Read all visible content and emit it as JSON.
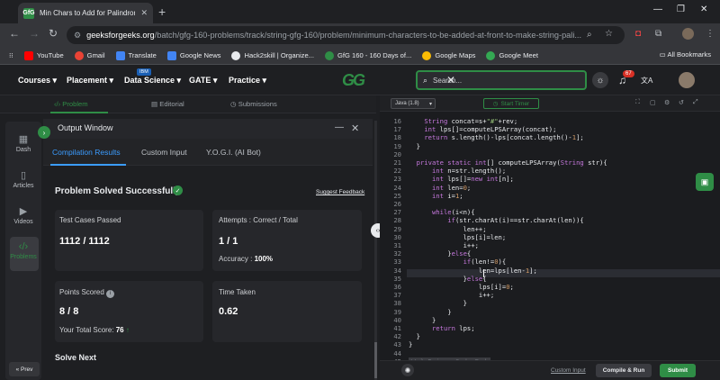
{
  "browser": {
    "tab_title": "Min Chars to Add for Palindrome |",
    "tab_favicon": "GfG",
    "new_tab": "+",
    "url_host": "geeksforgeeks.org",
    "url_path": "/batch/gfg-160-problems/track/string-gfg-160/problem/minimum-characters-to-be-added-at-front-to-make-string-pali...",
    "bookmarks": [
      "YouTube",
      "Gmail",
      "Translate",
      "Google News",
      "Hack2skill | Organize...",
      "GfG 160 - 160 Days of...",
      "Google Maps",
      "Google Meet"
    ],
    "all_bookmarks": "All Bookmarks",
    "notification_count": "67"
  },
  "nav": {
    "items": [
      "Courses",
      "Placement",
      "Data Science",
      "GATE",
      "Practice"
    ],
    "ibm_badge": "IBM",
    "logo": "GG",
    "search_placeholder": "Search..."
  },
  "problem_tabs": [
    "Problem",
    "Editorial",
    "Submissions"
  ],
  "sidebar": {
    "items": [
      "Dash",
      "Articles",
      "Videos",
      "Problems"
    ],
    "prev": "« Prev"
  },
  "output": {
    "title": "Output Window",
    "tabs": [
      "Compilation Results",
      "Custom Input",
      "Y.O.G.I. (AI Bot)"
    ],
    "status": "Problem Solved Successfully",
    "feedback": "Suggest Feedback",
    "cards": {
      "tests_label": "Test Cases Passed",
      "tests_value": "1112 / 1112",
      "attempts_label": "Attempts : Correct / Total",
      "attempts_value": "1 / 1",
      "accuracy_label": "Accuracy :",
      "accuracy_value": "100%",
      "points_label": "Points Scored",
      "points_value": "8 / 8",
      "total_label": "Your Total Score:",
      "total_value": "76",
      "time_label": "Time Taken",
      "time_value": "0.62"
    },
    "solve_next": "Solve Next"
  },
  "editor": {
    "language": "Java (1.8)",
    "timer": "Start Timer",
    "custom_input": "Custom Input",
    "compile": "Compile & Run",
    "submit": "Submit",
    "lines": [
      {
        "n": "16",
        "t": "    String concat=s+\"#\"+rev;"
      },
      {
        "n": "17",
        "t": "    int lps[]=computeLPSArray(concat);"
      },
      {
        "n": "18",
        "t": "    return s.length()-lps[concat.length()-1];"
      },
      {
        "n": "19",
        "t": "  }"
      },
      {
        "n": "20",
        "t": ""
      },
      {
        "n": "21",
        "t": "  private static int[] computeLPSArray(String str){"
      },
      {
        "n": "22",
        "t": "      int n=str.length();"
      },
      {
        "n": "23",
        "t": "      int lps[]=new int[n];"
      },
      {
        "n": "24",
        "t": "      int len=0;"
      },
      {
        "n": "25",
        "t": "      int i=1;"
      },
      {
        "n": "26",
        "t": ""
      },
      {
        "n": "27",
        "t": "      while(i<n){"
      },
      {
        "n": "28",
        "t": "          if(str.charAt(i)==str.charAt(len)){"
      },
      {
        "n": "29",
        "t": "              len++;"
      },
      {
        "n": "30",
        "t": "              lps[i]=len;"
      },
      {
        "n": "31",
        "t": "              i++;"
      },
      {
        "n": "32",
        "t": "          }else{"
      },
      {
        "n": "33",
        "t": "              if(len!=0){"
      },
      {
        "n": "34",
        "t": "                  len=lps[len-1];"
      },
      {
        "n": "35",
        "t": "              }else{"
      },
      {
        "n": "36",
        "t": "                  lps[i]=0;"
      },
      {
        "n": "37",
        "t": "                  i++;"
      },
      {
        "n": "38",
        "t": "              }"
      },
      {
        "n": "39",
        "t": "          }"
      },
      {
        "n": "40",
        "t": "      }"
      },
      {
        "n": "41",
        "t": "      return lps;"
      },
      {
        "n": "42",
        "t": "  }"
      },
      {
        "n": "43",
        "t": "}"
      },
      {
        "n": "44",
        "t": ""
      },
      {
        "n": "45",
        "t": "// } Driver Code Ends"
      }
    ]
  },
  "colors": {
    "accent_green": "#2f8d46",
    "tab_blue": "#3b9cff",
    "notification_red": "#d93025"
  }
}
